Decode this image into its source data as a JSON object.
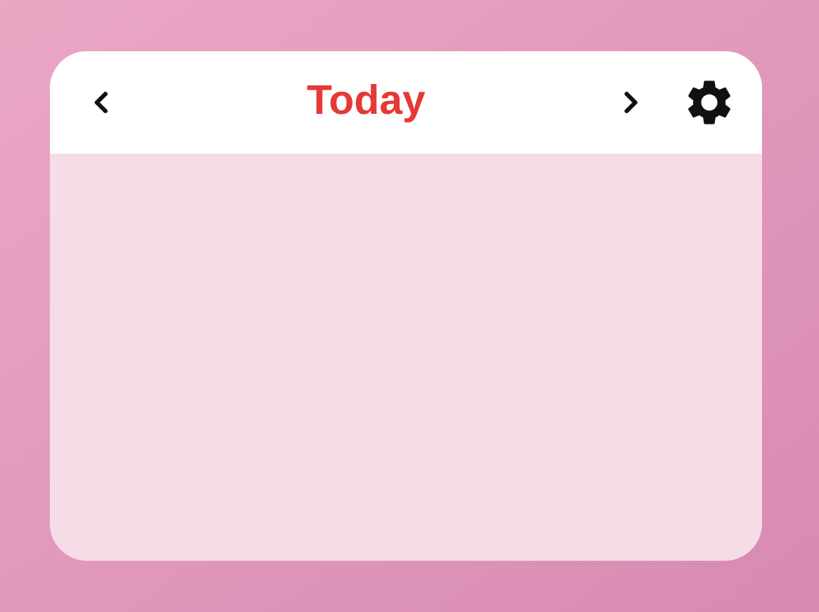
{
  "header": {
    "title": "Today"
  }
}
